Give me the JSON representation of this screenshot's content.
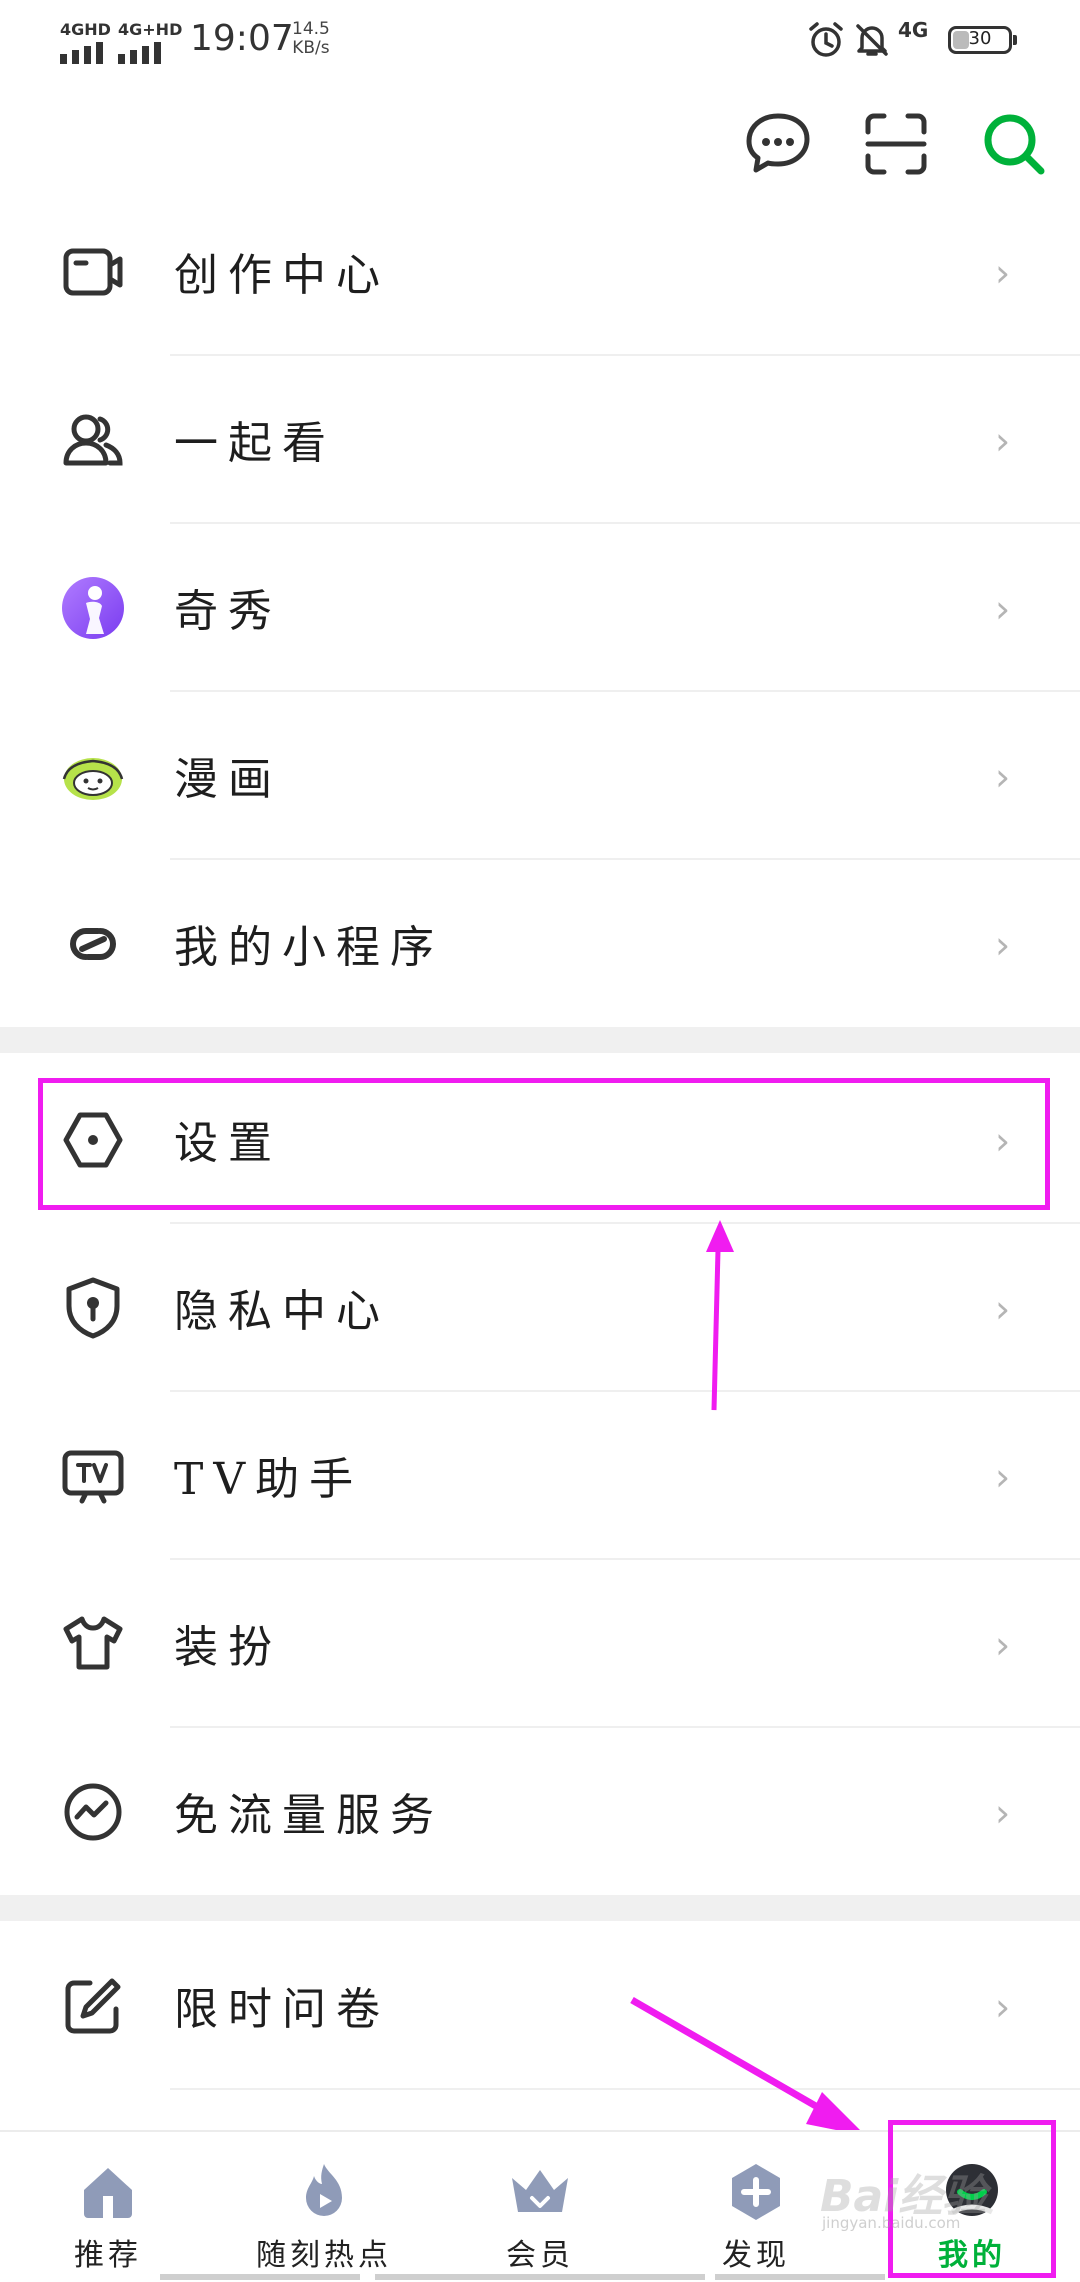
{
  "status_bar": {
    "sim1": "4GHD",
    "sim2": "4G+HD",
    "time": "19:07",
    "speed_value": "14.5",
    "speed_unit": "KB/s",
    "network": "4G",
    "battery": "30",
    "battery_level": 0.3,
    "icons": [
      "alarm-icon",
      "bell-off-icon"
    ]
  },
  "top_icons": [
    "message-icon",
    "scan-icon",
    "search-icon"
  ],
  "accent_color": "#00b13a",
  "highlight_color": "#f01cf0",
  "menu_groups": [
    [
      {
        "label": "创作中心",
        "icon": "camera-icon"
      },
      {
        "label": "一起看",
        "icon": "users-icon"
      },
      {
        "label": "奇秀",
        "icon": "qixiu-icon"
      },
      {
        "label": "漫画",
        "icon": "comic-icon"
      },
      {
        "label": "我的小程序",
        "icon": "mini-program-icon"
      }
    ],
    [
      {
        "label": "设置",
        "icon": "settings-icon"
      },
      {
        "label": "隐私中心",
        "icon": "privacy-shield-icon"
      },
      {
        "label": "TV助手",
        "icon": "tv-icon"
      },
      {
        "label": "装扮",
        "icon": "tshirt-icon"
      },
      {
        "label": "免流量服务",
        "icon": "data-free-icon"
      }
    ],
    [
      {
        "label": "限时问卷",
        "icon": "edit-icon"
      }
    ]
  ],
  "chevron": "›",
  "bottom_nav": [
    {
      "label": "推荐",
      "icon": "home-icon"
    },
    {
      "label": "随刻热点",
      "icon": "fire-icon"
    },
    {
      "label": "会员",
      "icon": "crown-icon"
    },
    {
      "label": "发现",
      "icon": "plus-icon"
    },
    {
      "label": "我的",
      "icon": "avatar-icon",
      "active": true
    }
  ],
  "watermark": {
    "text": "Bai经验",
    "sub": "jingyan.baidu.com"
  }
}
